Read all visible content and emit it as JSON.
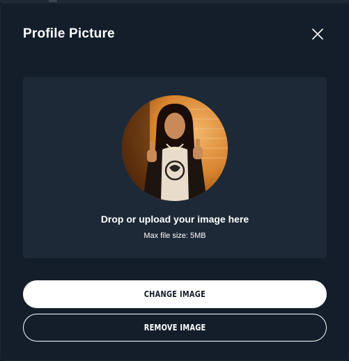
{
  "modal": {
    "title": "Profile Picture",
    "close_icon": "close-icon"
  },
  "dropzone": {
    "title": "Drop or upload your image here",
    "subtitle": "Max file size: 5MB",
    "avatar_icon": "profile-photo"
  },
  "actions": {
    "change_label": "CHANGE IMAGE",
    "remove_label": "REMOVE IMAGE"
  },
  "colors": {
    "background": "#141e2b",
    "dropzone": "#1e2937",
    "primary_button": "#ffffff",
    "text": "#ffffff"
  }
}
